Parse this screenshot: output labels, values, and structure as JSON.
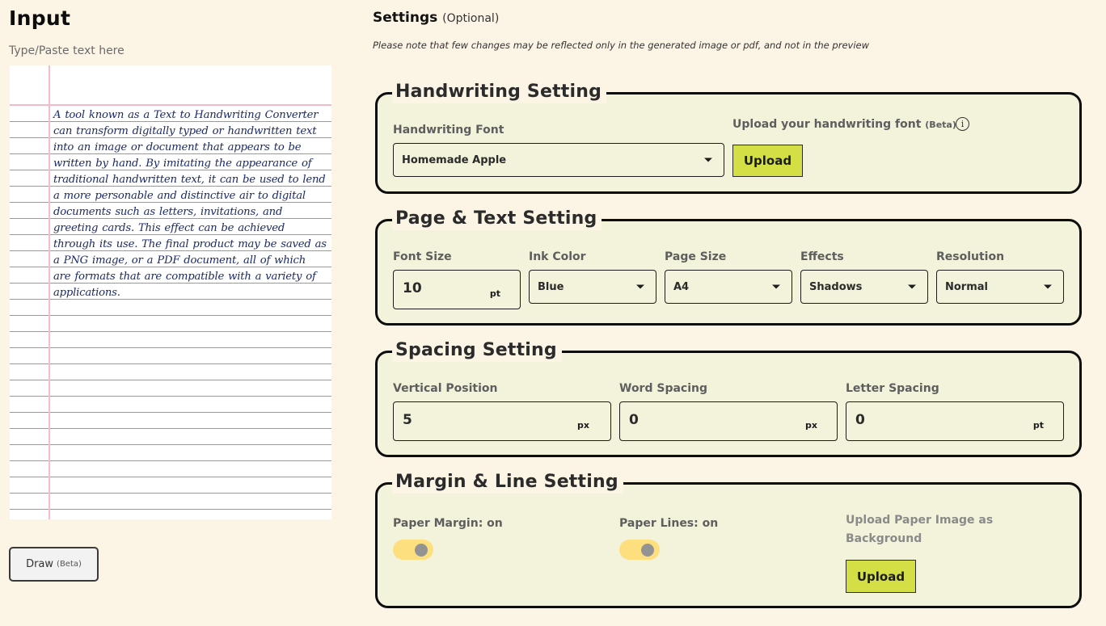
{
  "input": {
    "title": "Input",
    "hint": "Type/Paste text here",
    "handwritten_text": "A tool known as a Text to Handwriting Converter can transform digitally typed or handwritten text into an image or document that appears to be written by hand. By imitating the appearance of traditional handwritten text, it can be used to lend a more personable and distinctive air to digital documents such as letters, invitations, and greeting cards. This effect can be achieved through its use. The final product may be saved as a PNG image, or a PDF document, all of which are formats that are compatible with a variety of applications.",
    "ink_color": "#1b2a6b",
    "margin_color": "#f6bccb",
    "line_color": "#9a9a9a",
    "draw_button": {
      "label": "Draw",
      "badge": "(Beta)"
    }
  },
  "settings": {
    "title": "Settings",
    "title_suffix": "(Optional)",
    "note": "Please note that few changes may be reflected only in the generated image or pdf, and not in the preview",
    "handwriting": {
      "legend": "Handwriting Setting",
      "font_label": "Handwriting Font",
      "font_value": "Homemade Apple",
      "upload_label": "Upload your handwriting font",
      "upload_badge": "(Beta)",
      "info_icon": "info-icon",
      "upload_button": "Upload"
    },
    "page_text": {
      "legend": "Page & Text Setting",
      "font_size": {
        "label": "Font Size",
        "value": "10",
        "unit": "pt"
      },
      "ink_color": {
        "label": "Ink Color",
        "value": "Blue"
      },
      "page_size": {
        "label": "Page Size",
        "value": "A4"
      },
      "effects": {
        "label": "Effects",
        "value": "Shadows"
      },
      "resolution": {
        "label": "Resolution",
        "value": "Normal"
      }
    },
    "spacing": {
      "legend": "Spacing Setting",
      "vertical_position": {
        "label": "Vertical Position",
        "value": "5",
        "unit": "px"
      },
      "word_spacing": {
        "label": "Word Spacing",
        "value": "0",
        "unit": "px"
      },
      "letter_spacing": {
        "label": "Letter Spacing",
        "value": "0",
        "unit": "pt"
      }
    },
    "margin_line": {
      "legend": "Margin & Line Setting",
      "paper_margin": {
        "label": "Paper Margin: on",
        "on": true
      },
      "paper_lines": {
        "label": "Paper Lines: on",
        "on": true
      },
      "bg_upload_label": "Upload Paper Image as Background",
      "upload_button": "Upload"
    }
  },
  "colors": {
    "page_bg": "#fcf5e6",
    "panel_bg": "#f3f3dc",
    "accent_button": "#d4df45",
    "toggle_on": "#fedf7f"
  }
}
